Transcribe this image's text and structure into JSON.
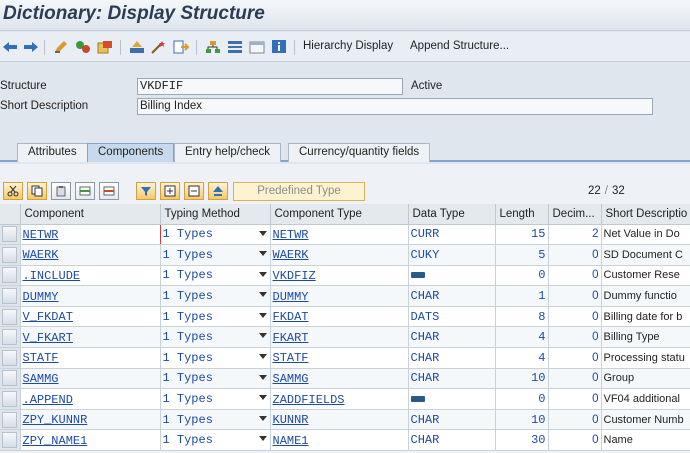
{
  "title": "Dictionary: Display Structure",
  "toolbar": {
    "hierarchy_display": "Hierarchy Display",
    "append_structure": "Append Structure..."
  },
  "header": {
    "structure_label": "Structure",
    "structure_value": "VKDFIF",
    "status": "Active",
    "short_desc_label": "Short Description",
    "short_desc_value": "Billing Index"
  },
  "tabs": [
    "Attributes",
    "Components",
    "Entry help/check",
    "Currency/quantity fields"
  ],
  "active_tab": "Components",
  "grid_toolbar": {
    "predefined_type": "Predefined Type",
    "counter_current": "22",
    "counter_total": "32"
  },
  "columns": [
    "Component",
    "Typing Method",
    "Component Type",
    "Data Type",
    "Length",
    "Decim...",
    "Short Descriptio"
  ],
  "rows": [
    {
      "component": "NETWR",
      "typing": "1 Types",
      "comp_type": "NETWR",
      "data_type": "CURR",
      "length": "15",
      "decimals": "2",
      "desc": "Net Value in Do"
    },
    {
      "component": "WAERK",
      "typing": "1 Types",
      "comp_type": "WAERK",
      "data_type": "CUKY",
      "length": "5",
      "decimals": "0",
      "desc": "SD Document C"
    },
    {
      "component": ".INCLUDE",
      "typing": "1 Types",
      "comp_type": "VKDFIZ",
      "data_type": "",
      "length": "0",
      "decimals": "0",
      "desc": "Customer Rese"
    },
    {
      "component": "DUMMY",
      "typing": "1 Types",
      "comp_type": "DUMMY",
      "data_type": "CHAR",
      "length": "1",
      "decimals": "0",
      "desc": "Dummy functio"
    },
    {
      "component": "V_FKDAT",
      "typing": "1 Types",
      "comp_type": "FKDAT",
      "data_type": "DATS",
      "length": "8",
      "decimals": "0",
      "desc": "Billing date for b"
    },
    {
      "component": "V_FKART",
      "typing": "1 Types",
      "comp_type": "FKART",
      "data_type": "CHAR",
      "length": "4",
      "decimals": "0",
      "desc": "Billing Type"
    },
    {
      "component": "STATF",
      "typing": "1 Types",
      "comp_type": "STATF",
      "data_type": "CHAR",
      "length": "4",
      "decimals": "0",
      "desc": "Processing statu"
    },
    {
      "component": "SAMMG",
      "typing": "1 Types",
      "comp_type": "SAMMG",
      "data_type": "CHAR",
      "length": "10",
      "decimals": "0",
      "desc": "Group"
    },
    {
      "component": ".APPEND",
      "typing": "1 Types",
      "comp_type": "ZADDFIELDS",
      "data_type": "",
      "length": "0",
      "decimals": "0",
      "desc": "VF04 additional"
    },
    {
      "component": "ZPY_KUNNR",
      "typing": "1 Types",
      "comp_type": "KUNNR",
      "data_type": "CHAR",
      "length": "10",
      "decimals": "0",
      "desc": "Customer Numb"
    },
    {
      "component": "ZPY_NAME1",
      "typing": "1 Types",
      "comp_type": "NAME1",
      "data_type": "CHAR",
      "length": "30",
      "decimals": "0",
      "desc": "Name"
    }
  ]
}
